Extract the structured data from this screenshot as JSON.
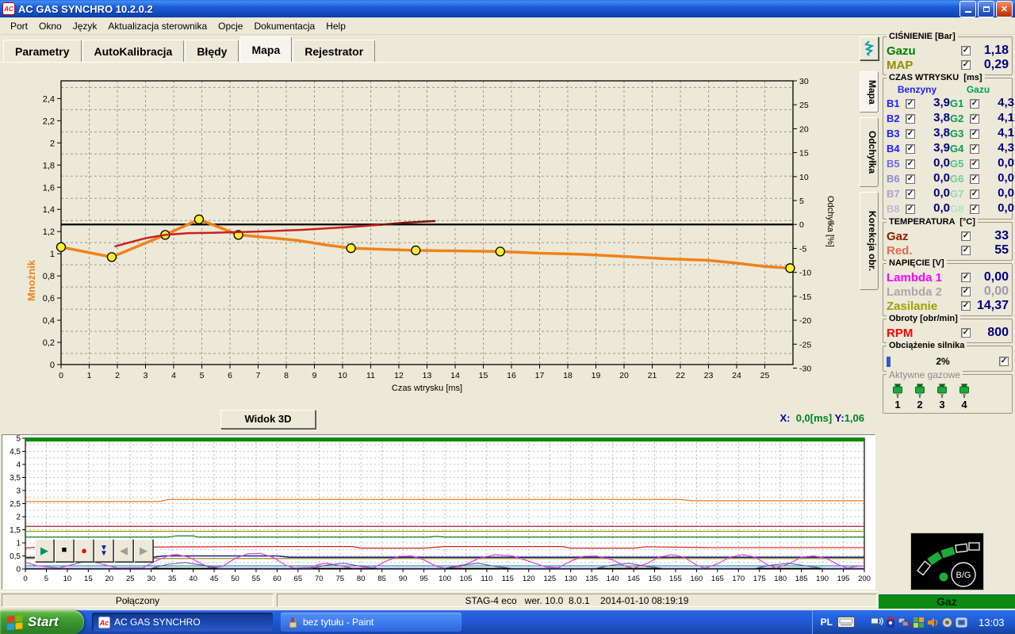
{
  "window": {
    "title": "AC GAS SYNCHRO  10.2.0.2"
  },
  "menu": [
    "Port",
    "Okno",
    "Język",
    "Aktualizacja sterownika",
    "Opcje",
    "Dokumentacja",
    "Help"
  ],
  "tabs": [
    "Parametry",
    "AutoKalibracja",
    "Błędy",
    "Mapa",
    "Rejestrator"
  ],
  "active_tab": "Mapa",
  "side_tabs": [
    "Mapa",
    "Odchyłka",
    "Korekcja obr."
  ],
  "map_view": {
    "button_3d": "Widok 3D",
    "readout": {
      "x_label": "X:",
      "x_value": "0,0[ms]",
      "y_label": "Y:",
      "y_value": "1,06"
    }
  },
  "chart_data": [
    {
      "type": "line",
      "title": "Mapa mnożnika",
      "xlabel": "Czas wtrysku [ms]",
      "ylabel_left": "Mnożnik",
      "ylabel_right": "Odchyłka [%]",
      "xlim": [
        0,
        26
      ],
      "ylim": [
        0,
        2.56
      ],
      "right_ylim": [
        -30,
        30
      ],
      "x_tick_step": 1,
      "y_tick_step": 0.2,
      "right_tick_step": 5,
      "zero_line_value": 1.264,
      "grid": "dashed",
      "axis_color": "#f08218",
      "series": [
        {
          "name": "mnoznik-mapa",
          "color": "#f08218",
          "width": 3.5,
          "points": [
            [
              0,
              1.06
            ],
            [
              1.8,
              0.97
            ],
            [
              3.7,
              1.17
            ],
            [
              4.9,
              1.31
            ],
            [
              6.3,
              1.17
            ],
            [
              7.4,
              1.145
            ],
            [
              8.4,
              1.12
            ],
            [
              9.4,
              1.08
            ],
            [
              10.3,
              1.05
            ],
            [
              11.4,
              1.04
            ],
            [
              12.6,
              1.03
            ],
            [
              14.1,
              1.025
            ],
            [
              15.6,
              1.02
            ],
            [
              17,
              1.005
            ],
            [
              18.5,
              0.995
            ],
            [
              20,
              0.975
            ],
            [
              21.5,
              0.955
            ],
            [
              23,
              0.94
            ],
            [
              24,
              0.915
            ],
            [
              25,
              0.885
            ],
            [
              25.9,
              0.87
            ]
          ],
          "markers": [
            [
              0,
              1.06
            ],
            [
              1.8,
              0.97
            ],
            [
              3.7,
              1.17
            ],
            [
              4.9,
              1.31
            ],
            [
              6.3,
              1.17
            ],
            [
              10.3,
              1.05
            ],
            [
              12.6,
              1.03
            ],
            [
              15.6,
              1.02
            ],
            [
              25.9,
              0.87
            ]
          ],
          "marker_fill": "#ffee33",
          "marker_stroke": "#000000"
        },
        {
          "name": "korekcja-biezaca",
          "color": "#cc2018",
          "width": 2.5,
          "points": [
            [
              1.9,
              1.065
            ],
            [
              2.4,
              1.1
            ],
            [
              3.0,
              1.14
            ],
            [
              3.7,
              1.17
            ],
            [
              4.5,
              1.185
            ],
            [
              5.5,
              1.19
            ],
            [
              7,
              1.2
            ],
            [
              8.5,
              1.215
            ],
            [
              9.5,
              1.23
            ],
            [
              10.5,
              1.245
            ],
            [
              11.3,
              1.26
            ]
          ]
        },
        {
          "name": "korekcja-ciemna",
          "color": "#7a100c",
          "width": 2.5,
          "points": [
            [
              11.3,
              1.26
            ],
            [
              12.2,
              1.28
            ],
            [
              13.3,
              1.295
            ]
          ]
        }
      ]
    },
    {
      "type": "line",
      "title": "Rejestrator przebiegów",
      "xlabel": "",
      "xlim": [
        0,
        200
      ],
      "ylim": [
        0,
        5
      ],
      "x_tick_step": 5,
      "y_tick_step": 0.5,
      "grid": "dashed",
      "series": [
        {
          "name": "line-green-5v",
          "color": "#0a8a0a",
          "width": 5,
          "points": [
            [
              0,
              4.95
            ],
            [
              200,
              4.95
            ]
          ]
        },
        {
          "name": "line-orange",
          "color": "#f07820",
          "width": 1.2,
          "points": [
            [
              0,
              2.58
            ],
            [
              32,
              2.58
            ],
            [
              34,
              2.66
            ],
            [
              156,
              2.66
            ],
            [
              159,
              2.61
            ],
            [
              200,
              2.61
            ]
          ]
        },
        {
          "name": "line-maroon",
          "color": "#801010",
          "width": 1.2,
          "points": [
            [
              0,
              1.63
            ],
            [
              200,
              1.63
            ]
          ]
        },
        {
          "name": "line-olive-high",
          "color": "#9a9a00",
          "width": 1.2,
          "points": [
            [
              0,
              1.44
            ],
            [
              200,
              1.44
            ]
          ]
        },
        {
          "name": "line-green-mid",
          "color": "#108030",
          "width": 1.2,
          "points": [
            [
              0,
              1.22
            ],
            [
              34,
              1.22
            ],
            [
              36,
              1.27
            ],
            [
              40,
              1.27
            ],
            [
              41,
              1.22
            ],
            [
              96,
              1.22
            ],
            [
              98,
              1.25
            ],
            [
              100,
              1.22
            ],
            [
              200,
              1.22
            ]
          ]
        },
        {
          "name": "line-red",
          "color": "#d02020",
          "width": 1.2,
          "points": [
            [
              0,
              0.8
            ],
            [
              6,
              0.88
            ],
            [
              11,
              0.8
            ],
            [
              30,
              0.84
            ],
            [
              60,
              0.86
            ],
            [
              78,
              0.86
            ],
            [
              80,
              0.8
            ],
            [
              95,
              0.8
            ],
            [
              100,
              0.86
            ],
            [
              128,
              0.86
            ],
            [
              130,
              0.8
            ],
            [
              145,
              0.8
            ],
            [
              148,
              0.85
            ],
            [
              163,
              0.82
            ],
            [
              200,
              0.82
            ]
          ]
        },
        {
          "name": "line-navy",
          "color": "#202080",
          "width": 1.6,
          "points": [
            [
              0,
              0.44
            ],
            [
              30,
              0.44
            ],
            [
              33,
              0.5
            ],
            [
              60,
              0.5
            ],
            [
              63,
              0.45
            ],
            [
              200,
              0.45
            ]
          ]
        },
        {
          "name": "line-olive-low",
          "color": "#808000",
          "width": 1.2,
          "points": [
            [
              0,
              0.4
            ],
            [
              200,
              0.4
            ]
          ]
        },
        {
          "name": "line-teal",
          "color": "#009090",
          "width": 1.2,
          "points": [
            [
              0,
              0.12
            ],
            [
              200,
              0.12
            ]
          ]
        },
        {
          "name": "line-black",
          "color": "#000000",
          "width": 1,
          "points": [
            [
              0,
              0.03
            ],
            [
              200,
              0.03
            ]
          ]
        },
        {
          "name": "lambda-magenta",
          "color": "#e040d0",
          "width": 1.2,
          "points": [
            [
              0,
              0.25
            ],
            [
              3,
              0.12
            ],
            [
              8,
              0.04
            ],
            [
              12,
              0.2
            ],
            [
              15,
              0.32
            ],
            [
              18,
              0.2
            ],
            [
              22,
              0.04
            ],
            [
              28,
              0.05
            ],
            [
              31,
              0.3
            ],
            [
              34,
              0.5
            ],
            [
              36,
              0.56
            ],
            [
              39,
              0.45
            ],
            [
              42,
              0.2
            ],
            [
              44,
              0.05
            ],
            [
              47,
              0.1
            ],
            [
              50,
              0.4
            ],
            [
              53,
              0.58
            ],
            [
              56,
              0.6
            ],
            [
              59,
              0.45
            ],
            [
              62,
              0.15
            ],
            [
              64,
              0.04
            ],
            [
              68,
              0.06
            ],
            [
              70,
              0.18
            ],
            [
              72,
              0.22
            ],
            [
              75,
              0.12
            ],
            [
              78,
              0.04
            ],
            [
              83,
              0.05
            ],
            [
              86,
              0.3
            ],
            [
              89,
              0.48
            ],
            [
              92,
              0.5
            ],
            [
              95,
              0.35
            ],
            [
              98,
              0.1
            ],
            [
              100,
              0.04
            ],
            [
              104,
              0.1
            ],
            [
              108,
              0.4
            ],
            [
              112,
              0.55
            ],
            [
              116,
              0.5
            ],
            [
              120,
              0.3
            ],
            [
              124,
              0.08
            ],
            [
              127,
              0.05
            ],
            [
              130,
              0.3
            ],
            [
              133,
              0.48
            ],
            [
              136,
              0.5
            ],
            [
              140,
              0.35
            ],
            [
              143,
              0.1
            ],
            [
              145,
              0.04
            ],
            [
              148,
              0.2
            ],
            [
              151,
              0.45
            ],
            [
              154,
              0.55
            ],
            [
              157,
              0.45
            ],
            [
              160,
              0.15
            ],
            [
              162,
              0.04
            ],
            [
              165,
              0.2
            ],
            [
              168,
              0.45
            ],
            [
              171,
              0.55
            ],
            [
              174,
              0.45
            ],
            [
              177,
              0.15
            ],
            [
              179,
              0.04
            ],
            [
              182,
              0.2
            ],
            [
              185,
              0.45
            ],
            [
              188,
              0.5
            ],
            [
              191,
              0.4
            ],
            [
              194,
              0.15
            ],
            [
              196,
              0.04
            ],
            [
              198,
              0.1
            ],
            [
              200,
              0.12
            ]
          ]
        },
        {
          "name": "lambda-violet",
          "color": "#6040c0",
          "width": 1,
          "points": [
            [
              0,
              0.03
            ],
            [
              30,
              0.03
            ],
            [
              34,
              0.18
            ],
            [
              38,
              0.25
            ],
            [
              42,
              0.15
            ],
            [
              46,
              0.03
            ],
            [
              68,
              0.03
            ],
            [
              72,
              0.15
            ],
            [
              76,
              0.22
            ],
            [
              80,
              0.1
            ],
            [
              84,
              0.03
            ],
            [
              100,
              0.03
            ],
            [
              104,
              0.15
            ],
            [
              108,
              0.22
            ],
            [
              112,
              0.1
            ],
            [
              116,
              0.03
            ],
            [
              136,
              0.03
            ],
            [
              140,
              0.15
            ],
            [
              144,
              0.22
            ],
            [
              148,
              0.1
            ],
            [
              152,
              0.03
            ],
            [
              174,
              0.03
            ],
            [
              178,
              0.15
            ],
            [
              182,
              0.22
            ],
            [
              186,
              0.12
            ],
            [
              190,
              0.03
            ],
            [
              200,
              0.03
            ]
          ]
        }
      ]
    }
  ],
  "sidebar": {
    "pressure": {
      "title": "CIŚNIENIE [Bar]",
      "rows": [
        {
          "label": "Gazu",
          "color": "#008000",
          "checked": true,
          "value": "1,18"
        },
        {
          "label": "MAP",
          "color": "#909000",
          "checked": true,
          "value": "0,29"
        }
      ]
    },
    "injection": {
      "title": "CZAS WTRYSKU  [ms]",
      "col_benzyny": "Benzyny",
      "col_gazu": "Gazu",
      "col_benzyny_color": "#2020ff",
      "col_gazu_color": "#00a050",
      "rows": [
        {
          "b": "B1",
          "bcolor": "#2020ff",
          "bval": "3,9",
          "g": "G1",
          "gcolor": "#00a050",
          "gval": "4,3"
        },
        {
          "b": "B2",
          "bcolor": "#2020ff",
          "bval": "3,8",
          "g": "G2",
          "gcolor": "#00a050",
          "gval": "4,1"
        },
        {
          "b": "B3",
          "bcolor": "#2020ff",
          "bval": "3,8",
          "g": "G3",
          "gcolor": "#00a050",
          "gval": "4,1"
        },
        {
          "b": "B4",
          "bcolor": "#2020ff",
          "bval": "3,9",
          "g": "G4",
          "gcolor": "#00a050",
          "gval": "4,3"
        },
        {
          "b": "B5",
          "bcolor": "#6a6ae4",
          "bval": "0,0",
          "g": "G5",
          "gcolor": "#54c084",
          "gval": "0,0"
        },
        {
          "b": "B6",
          "bcolor": "#8a8ad8",
          "bval": "0,0",
          "g": "G6",
          "gcolor": "#74cc9c",
          "gval": "0,0"
        },
        {
          "b": "B7",
          "bcolor": "#a4a4d4",
          "bval": "0,0",
          "g": "G7",
          "gcolor": "#94d8b4",
          "gval": "0,0"
        },
        {
          "b": "B8",
          "bcolor": "#bcbcd0",
          "bval": "0,0",
          "g": "G8",
          "gcolor": "#b4e4c8",
          "gval": "0,0"
        }
      ]
    },
    "temperature": {
      "title": "TEMPERATURA  [°C]",
      "rows": [
        {
          "label": "Gaz",
          "color": "#8b2000",
          "checked": true,
          "value": "33"
        },
        {
          "label": "Red.",
          "color": "#e86850",
          "checked": true,
          "value": "55"
        }
      ]
    },
    "voltage": {
      "title": "NAPIĘCIE [V]",
      "rows": [
        {
          "label": "Lambda 1",
          "color": "#ff00ff",
          "checked": true,
          "value": "0,00",
          "value_color": "#000080"
        },
        {
          "label": "Lambda 2",
          "color": "#a8a8a8",
          "checked": true,
          "value": "0,00",
          "value_color": "#9a9ab0"
        },
        {
          "label": "Zasilanie",
          "color": "#a0a000",
          "checked": true,
          "value": "14,37",
          "value_color": "#000080"
        }
      ]
    },
    "rpm": {
      "title": "Obroty [obr/min]",
      "rows": [
        {
          "label": "RPM",
          "color": "#ff0000",
          "checked": true,
          "value": "800"
        }
      ]
    },
    "load": {
      "title": "Obciążenie silnika",
      "percent": "2%",
      "checked": true
    },
    "active_injectors": {
      "title": "Aktywne gazowe",
      "items": [
        "1",
        "2",
        "3",
        "4"
      ]
    }
  },
  "led_panel": {
    "label": "B/G",
    "segments_on": 2,
    "segments_total": 5
  },
  "gas_bar_label": "Gaz",
  "status_bar": {
    "connection": "Połączony",
    "device_info": "STAG-4 eco   wer. 10.0  8.0.1    2014-01-10 08:19:19"
  },
  "taskbar": {
    "start": "Start",
    "tasks": [
      "AC GAS SYNCHRO",
      "bez tytułu - Paint"
    ],
    "tray": {
      "lang": "PL",
      "time": "13:03"
    }
  }
}
